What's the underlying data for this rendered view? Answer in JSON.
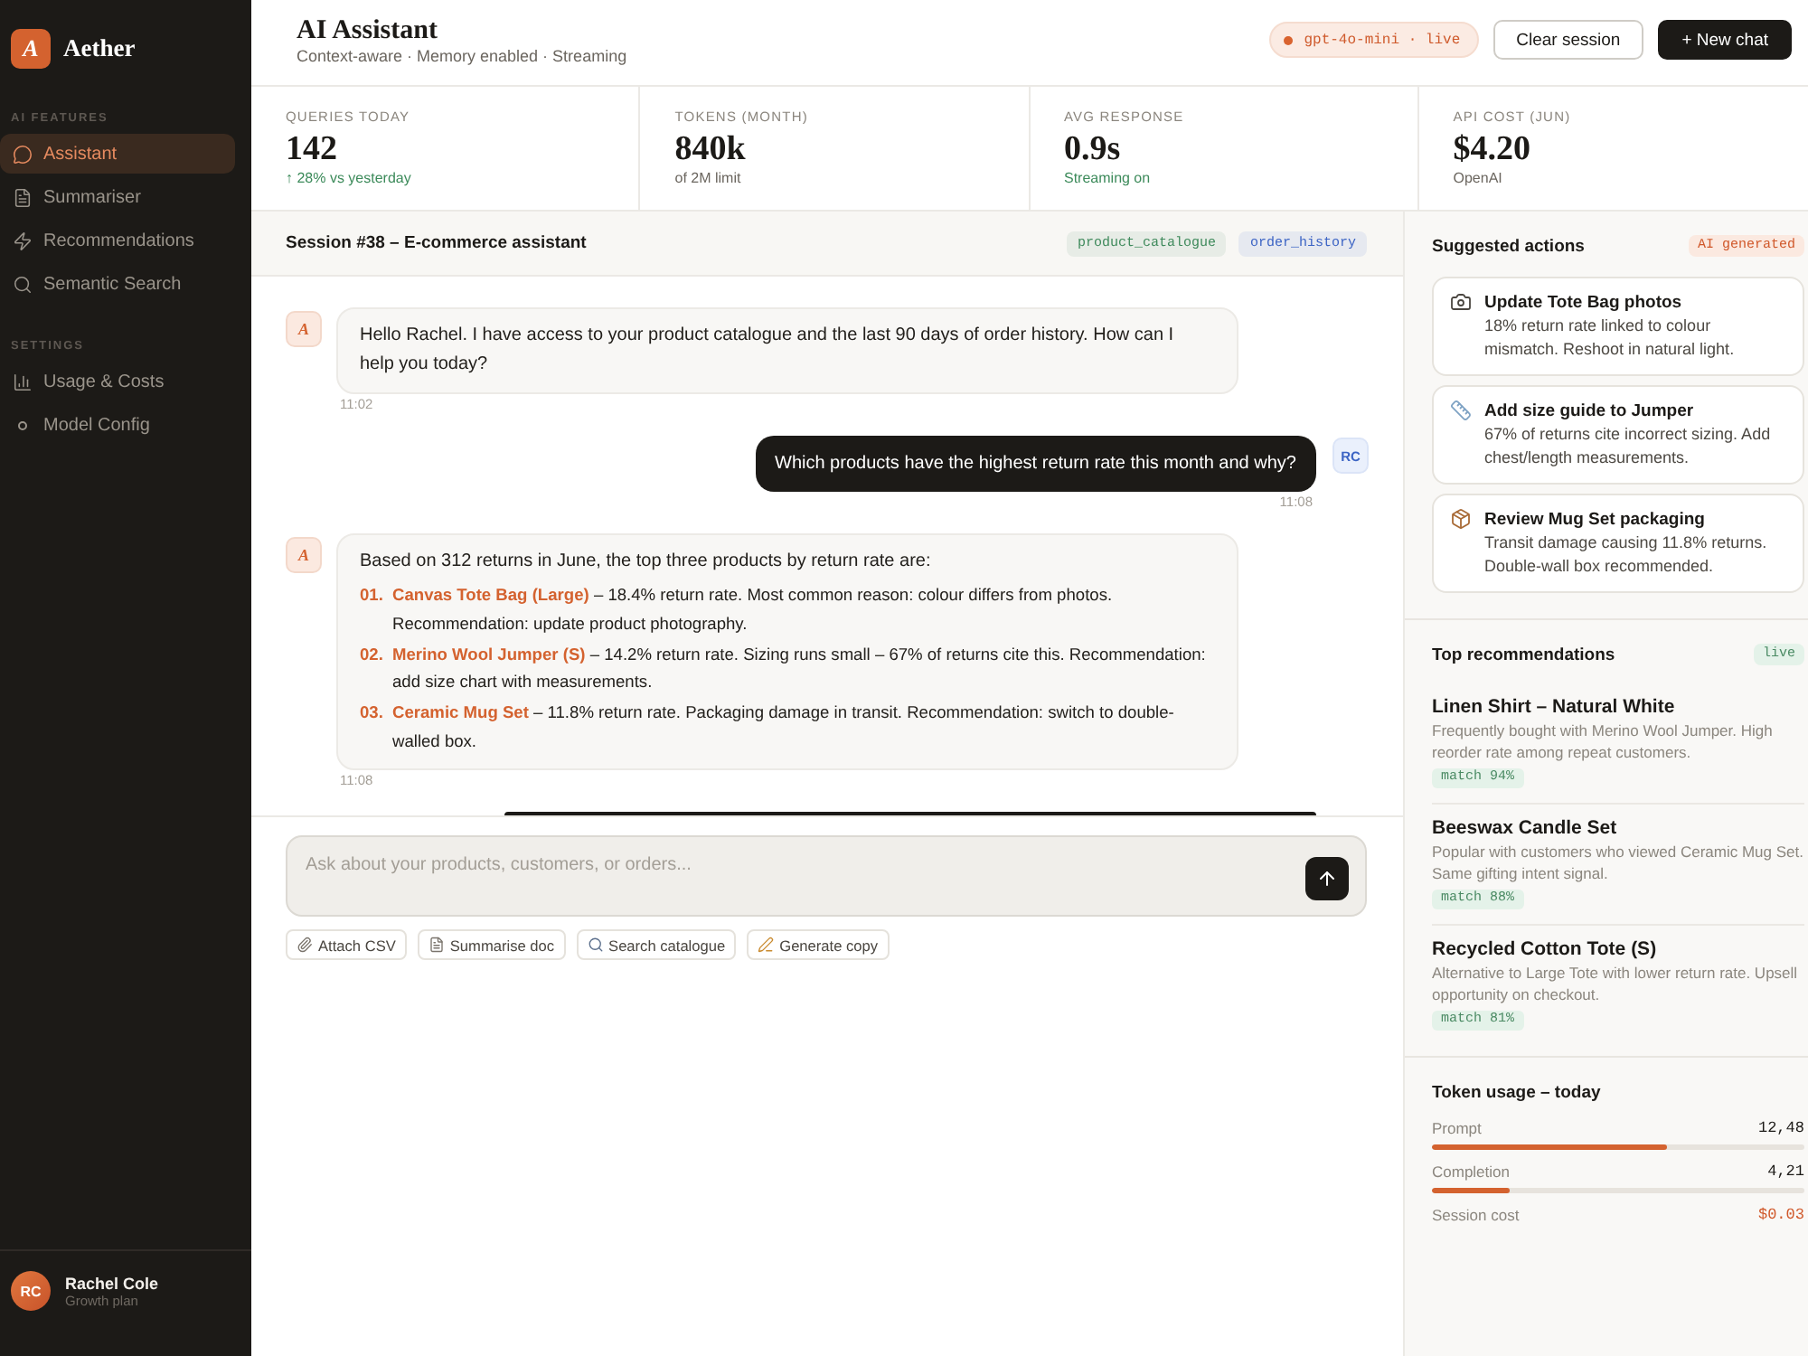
{
  "sidebar": {
    "brand": {
      "mark": "A",
      "name": "Aether"
    },
    "sections": [
      {
        "title": "AI FEATURES",
        "items": [
          {
            "label": "Assistant",
            "selected": true
          },
          {
            "label": "Summariser",
            "selected": false
          },
          {
            "label": "Recommendations",
            "selected": false
          },
          {
            "label": "Semantic Search",
            "selected": false
          }
        ]
      },
      {
        "title": "SETTINGS",
        "items": [
          {
            "label": "Usage & Costs",
            "selected": false
          },
          {
            "label": "Model Config",
            "selected": false
          }
        ]
      }
    ],
    "user": {
      "initials": "RC",
      "name": "Rachel Cole",
      "plan": "Growth plan"
    }
  },
  "header": {
    "title": "AI Assistant",
    "subtitle": "Context-aware · Memory enabled · Streaming",
    "model_badge": "gpt-4o-mini · live",
    "buttons": [
      {
        "label": "Clear session",
        "kind": "secondary"
      },
      {
        "label": "+ New chat",
        "kind": "primary"
      }
    ]
  },
  "stats": [
    {
      "label": "QUERIES TODAY",
      "value": "142",
      "note": "↑ 28% vs yesterday",
      "kind": "positive"
    },
    {
      "label": "TOKENS (MONTH)",
      "value": "840k",
      "note": "of 2M limit",
      "kind": "neutral"
    },
    {
      "label": "AVG RESPONSE",
      "value": "0.9s",
      "note": "Streaming on",
      "kind": "positive"
    },
    {
      "label": "API COST (JUN)",
      "value": "$4.20",
      "note": "OpenAI",
      "kind": "neutral"
    }
  ],
  "session": {
    "title": "Session #38 – E-commerce assistant",
    "tags": [
      {
        "label": "product_catalogue",
        "color": "#3f8a5c"
      },
      {
        "label": "order_history",
        "color": "#3b63c4"
      }
    ]
  },
  "messages": [
    {
      "kind": "assistant",
      "avatar": "A",
      "text": "Hello Rachel. I have access to your product catalogue and the last 90 days of order history. How can I help you today?",
      "time": "11:02"
    },
    {
      "kind": "user",
      "avatar": "RC",
      "text": "Which products have the highest return rate this month and why?",
      "time": "11:08"
    },
    {
      "kind": "list",
      "avatar": "A",
      "text": "Based on 312 returns in June, the top three products by return rate are:",
      "items": [
        {
          "number": "01.",
          "product": "Canvas Tote Bag (Large)",
          "text": "– 18.4% return rate. Most common reason: colour differs from photos. Recommendation: update product photography."
        },
        {
          "number": "02.",
          "product": "Merino Wool Jumper (S)",
          "text": "– 14.2% return rate. Sizing runs small – 67% of returns cite this. Recommendation: add size chart with measurements."
        },
        {
          "number": "03.",
          "product": "Ceramic Mug Set",
          "text": "– 11.8% return rate. Packaging damage in transit. Recommendation: switch to double-walled box."
        }
      ],
      "time": "11:08"
    },
    {
      "kind": "partial"
    }
  ],
  "composer": {
    "placeholder": "Ask about your products, customers, or orders...",
    "actions": [
      "Attach CSV",
      "Summarise doc",
      "Search catalogue",
      "Generate copy"
    ]
  },
  "suggested_actions": {
    "title": "Suggested actions",
    "badge": "AI generated",
    "items": [
      {
        "title": "Update Tote Bag photos",
        "text": "18% return rate linked to colour mismatch. Reshoot in natural light."
      },
      {
        "title": "Add size guide to Jumper",
        "text": "67% of returns cite incorrect sizing. Add chest/length measurements."
      },
      {
        "title": "Review Mug Set packaging",
        "text": "Transit damage causing 11.8% returns. Double-wall box recommended."
      }
    ]
  },
  "recommendations": {
    "title": "Top recommendations",
    "badge": "live",
    "items": [
      {
        "title": "Linen Shirt – Natural White",
        "text": "Frequently bought with Merino Wool Jumper. High reorder rate among repeat customers.",
        "match": "match 94%"
      },
      {
        "title": "Beeswax Candle Set",
        "text": "Popular with customers who viewed Ceramic Mug Set. Same gifting intent signal.",
        "match": "match 88%"
      },
      {
        "title": "Recycled Cotton Tote (S)",
        "text": "Alternative to Large Tote with lower return rate. Upsell opportunity on checkout.",
        "match": "match 81%"
      }
    ]
  },
  "token_usage": {
    "title": "Token usage – today",
    "rows": [
      {
        "kind": "meter",
        "label": "Prompt",
        "value": "12,48",
        "level": 0.63
      },
      {
        "kind": "meter",
        "label": "Completion",
        "value": "4,21",
        "level": 0.21
      },
      {
        "kind": "total",
        "label": "Session cost",
        "value": "$0.03"
      }
    ]
  }
}
